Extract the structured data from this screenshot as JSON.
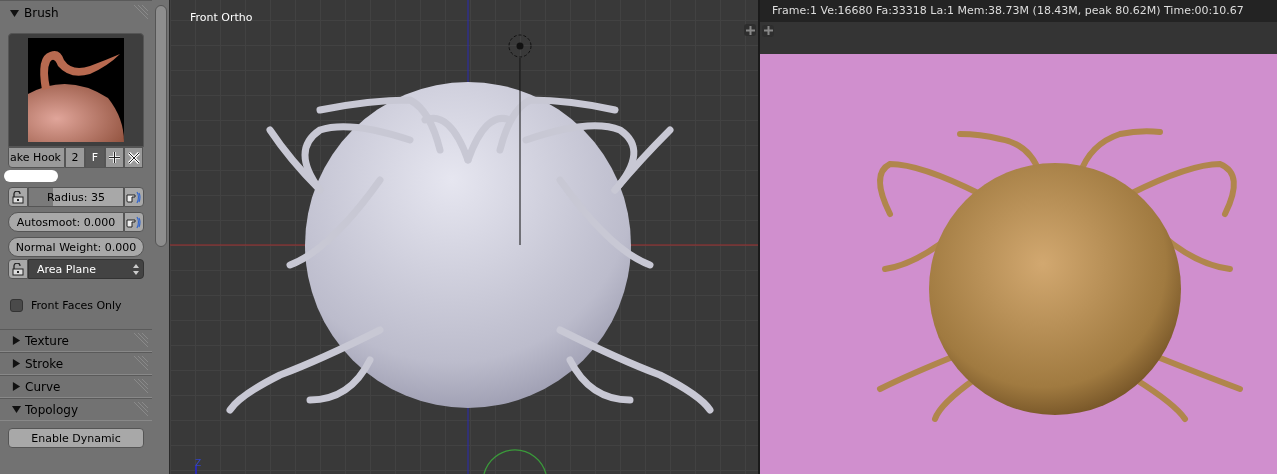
{
  "tool_panel": {
    "brush": {
      "title": "Brush",
      "expanded": true,
      "name": "ake Hook",
      "users": "2",
      "fake_user": {
        "label": "F",
        "on": true
      }
    },
    "sliders": [
      {
        "kind": "locked",
        "label": "Radius: 35",
        "level": 0.25
      },
      {
        "kind": "round",
        "label": "Autosmoot: 0.000"
      },
      {
        "kind": "plain",
        "label": "Normal Weight: 0.000"
      }
    ],
    "plane_dropdown": {
      "value": "Area Plane"
    },
    "front_faces_only": {
      "label": "Front Faces Only",
      "checked": false
    },
    "sections": [
      {
        "title": "Texture",
        "expanded": false
      },
      {
        "title": "Stroke",
        "expanded": false
      },
      {
        "title": "Curve",
        "expanded": false
      },
      {
        "title": "Topology",
        "expanded": true
      }
    ],
    "topology_button": "Enable Dynamic"
  },
  "viewport": {
    "view_label": "Front Ortho",
    "axis_label": "Z"
  },
  "render": {
    "status": "Frame:1 Ve:16680 Fa:33318 La:1 Mem:38.73M (18.43M, peak 80.62M) Time:00:10.67"
  }
}
